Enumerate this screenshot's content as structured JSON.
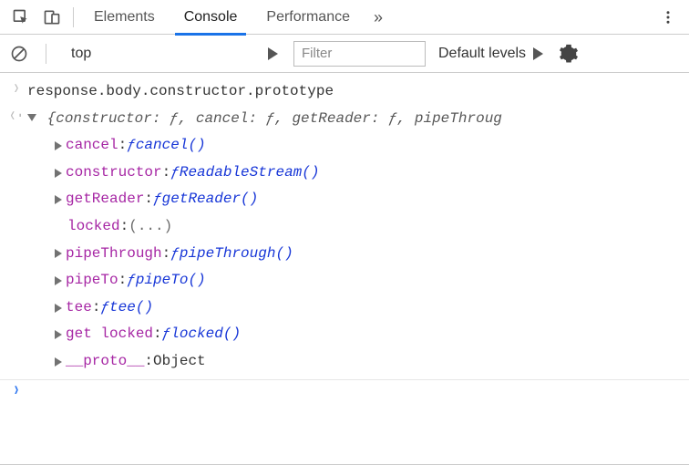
{
  "tabs": {
    "elements": "Elements",
    "console": "Console",
    "performance": "Performance",
    "overflow": "»"
  },
  "toolbar": {
    "context": "top",
    "filter_placeholder": "Filter",
    "levels": "Default levels"
  },
  "console": {
    "input": "response.body.constructor.prototype",
    "preview": "{constructor: ƒ, cancel: ƒ, getReader: ƒ, pipeThroug",
    "props": [
      {
        "key": "cancel",
        "val_lead": "ƒ ",
        "val_name": "cancel()",
        "arrow": true
      },
      {
        "key": "constructor",
        "val_lead": "ƒ ",
        "val_name": "ReadableStream()",
        "arrow": true
      },
      {
        "key": "getReader",
        "val_lead": "ƒ ",
        "val_name": "getReader()",
        "arrow": true
      },
      {
        "key": "locked",
        "val_lead": "",
        "val_name": "(...)",
        "arrow": false
      },
      {
        "key": "pipeThrough",
        "val_lead": "ƒ ",
        "val_name": "pipeThrough()",
        "arrow": true
      },
      {
        "key": "pipeTo",
        "val_lead": "ƒ ",
        "val_name": "pipeTo()",
        "arrow": true
      },
      {
        "key": "tee",
        "val_lead": "ƒ ",
        "val_name": "tee()",
        "arrow": true
      },
      {
        "key": "get locked",
        "val_lead": "ƒ ",
        "val_name": "locked()",
        "arrow": true
      },
      {
        "key": "__proto__",
        "val_lead": "",
        "val_name": "Object",
        "arrow": true
      }
    ]
  }
}
